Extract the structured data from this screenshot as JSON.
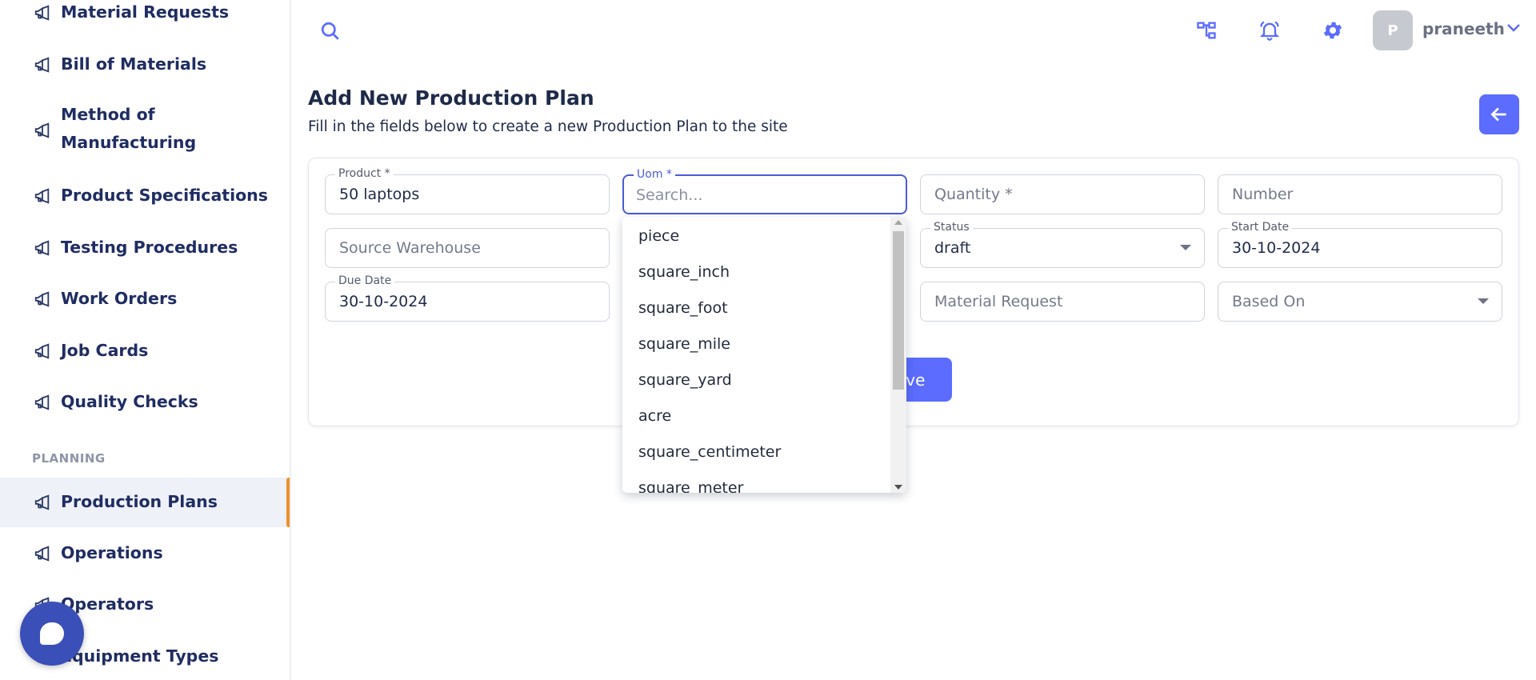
{
  "sidebar": {
    "items": [
      {
        "label": "Material Requests"
      },
      {
        "label": "Bill of Materials"
      },
      {
        "label": "Method of Manufacturing"
      },
      {
        "label": "Product Specifications"
      },
      {
        "label": "Testing Procedures"
      },
      {
        "label": "Work Orders"
      },
      {
        "label": "Job Cards"
      },
      {
        "label": "Quality Checks"
      },
      {
        "label": "Production Plans"
      },
      {
        "label": "Operations"
      },
      {
        "label": "Operators"
      },
      {
        "label": "Equipment Types"
      }
    ],
    "section_label": "PLANNING",
    "icon": "megaphone-icon",
    "active_item": "Production Plans",
    "active_color": "#f0902a"
  },
  "topbar": {
    "avatar_initial": "P",
    "username": "praneeth",
    "icons": [
      "search-icon",
      "hierarchy-icon",
      "bell-icon",
      "gear-icon",
      "chevron-down-icon"
    ]
  },
  "page": {
    "title": "Add New Production Plan",
    "subtitle": "Fill in the fields below to create a new Production Plan to the site"
  },
  "form": {
    "product": {
      "label": "Product *",
      "value": "50 laptops"
    },
    "uom": {
      "label": "Uom *",
      "placeholder": "Search..."
    },
    "quantity": {
      "placeholder": "Quantity *"
    },
    "number": {
      "placeholder": "Number"
    },
    "source_warehouse": {
      "placeholder": "Source Warehouse"
    },
    "status": {
      "label": "Status",
      "value": "draft"
    },
    "start_date": {
      "label": "Start Date",
      "value": "30-10-2024"
    },
    "due_date": {
      "label": "Due Date",
      "value": "30-10-2024"
    },
    "material_request": {
      "placeholder": "Material Request"
    },
    "based_on": {
      "placeholder": "Based On"
    },
    "save_label": "Save",
    "save_visible_text": "ave"
  },
  "uom_dropdown": {
    "options": [
      "piece",
      "square_inch",
      "square_foot",
      "square_mile",
      "square_yard",
      "acre",
      "square_centimeter",
      "square_meter"
    ]
  },
  "colors": {
    "accent": "#5b6cff",
    "nav_text": "#1f2d63",
    "chat_bubble": "#3b4fb8"
  }
}
